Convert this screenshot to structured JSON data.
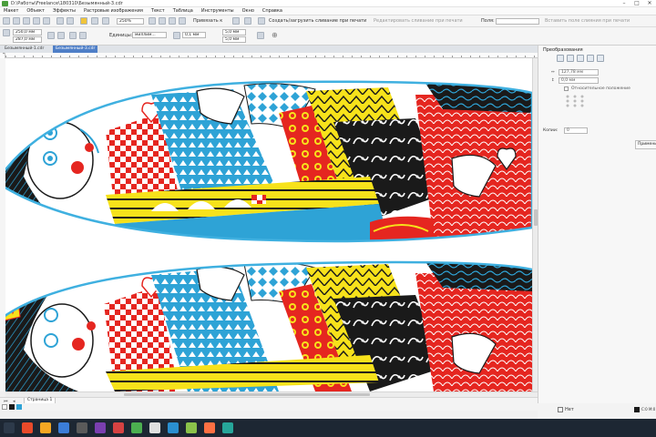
{
  "window": {
    "title": "D:\\Работы\\Freelance\\180310\\Безымянный-3.cdr",
    "controls": [
      "–",
      "□",
      "✕"
    ]
  },
  "menu": {
    "items": [
      "Макет",
      "Объект",
      "Эффекты",
      "Растровые изображения",
      "Текст",
      "Таблица",
      "Инструменты",
      "Окно",
      "Справка"
    ]
  },
  "std_toolbar": {
    "zoom_value": "250%",
    "snap_label": "Привязать к",
    "create_slice_label": "Создать/загрузить сливание при печати",
    "edit_slice_label": "Редактировать сливание при печати",
    "fields_label": "Поля:",
    "insert_label": "Вставить поле слияния при печати"
  },
  "prop_toolbar": {
    "width_value": "250,0 мм",
    "height_value": "287,0 мм",
    "units_label": "Единицы:",
    "units_value": "миллим...",
    "nudge_value": "0,1 мм",
    "dup_x_value": "5,0 мм",
    "dup_y_value": "5,0 мм"
  },
  "doc_tabs": [
    "Безымянный-1.cdr",
    "Безымянный-3.cdr"
  ],
  "page_tab": "Страница 1",
  "panel": {
    "title": "Преобразования",
    "x_value": "127,78 мм",
    "y_value": "0,0 мм",
    "relative_label": "Относительное положение",
    "copies_label": "Копии:",
    "copies_value": "0",
    "apply_label": "Применить"
  },
  "status": {
    "fill_label": "Нет",
    "outline_label": "C:0 M:0"
  },
  "colors": {
    "black": "#1a1a1a",
    "blue": "#2ea3d6",
    "red": "#e52620",
    "yellow": "#f7e21b",
    "white": "#ffffff",
    "outline": "#3fb0e0"
  }
}
